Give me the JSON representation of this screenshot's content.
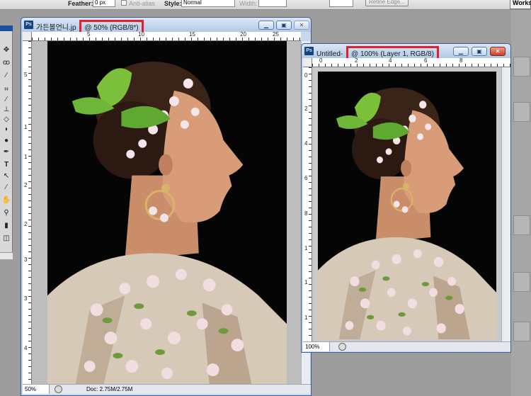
{
  "options_bar": {
    "feather_label": "Feather:",
    "feather_value": "0 px",
    "antialias_label": "Anti-alias",
    "style_label": "Style:",
    "style_value": "Normal",
    "width_label": "Width:",
    "refine_edge_label": "Refine Edge...",
    "workspace_label": "Works"
  },
  "windows": {
    "back": {
      "icon_text": "Ps",
      "filename": "가든볼언니.jp",
      "zoom_info": "@ 50% (RGB/8*)",
      "status_zoom": "50%",
      "status_doc": "Doc: 2.75M/2.75M",
      "ruler_top": [
        "5",
        "10",
        "15",
        "20",
        "25"
      ],
      "ruler_left": [
        "5",
        "1",
        "1",
        "2",
        "2",
        "3",
        "3",
        "4"
      ]
    },
    "front": {
      "icon_text": "Ps",
      "filename": "Untitled-",
      "zoom_info": "@ 100% (Layer 1, RGB/8)",
      "status_zoom": "100%",
      "ruler_top": [
        "0",
        "2",
        "4",
        "6",
        "8"
      ],
      "ruler_left": [
        "0",
        "2",
        "4",
        "6",
        "8",
        "1",
        "1",
        "1"
      ]
    }
  },
  "colors": {
    "highlight": "#e3202a",
    "titlebar": "#b3c9e6",
    "workspace": "#9d9d9d"
  },
  "icons": [
    "move-icon",
    "lasso-icon",
    "magic-wand-icon",
    "crop-icon",
    "brush-icon",
    "stamp-icon",
    "eraser-icon",
    "paint-bucket-icon",
    "dodge-icon",
    "pen-icon",
    "type-icon",
    "path-select-icon",
    "shape-icon",
    "eyedropper-icon",
    "hand-icon",
    "zoom-icon"
  ]
}
